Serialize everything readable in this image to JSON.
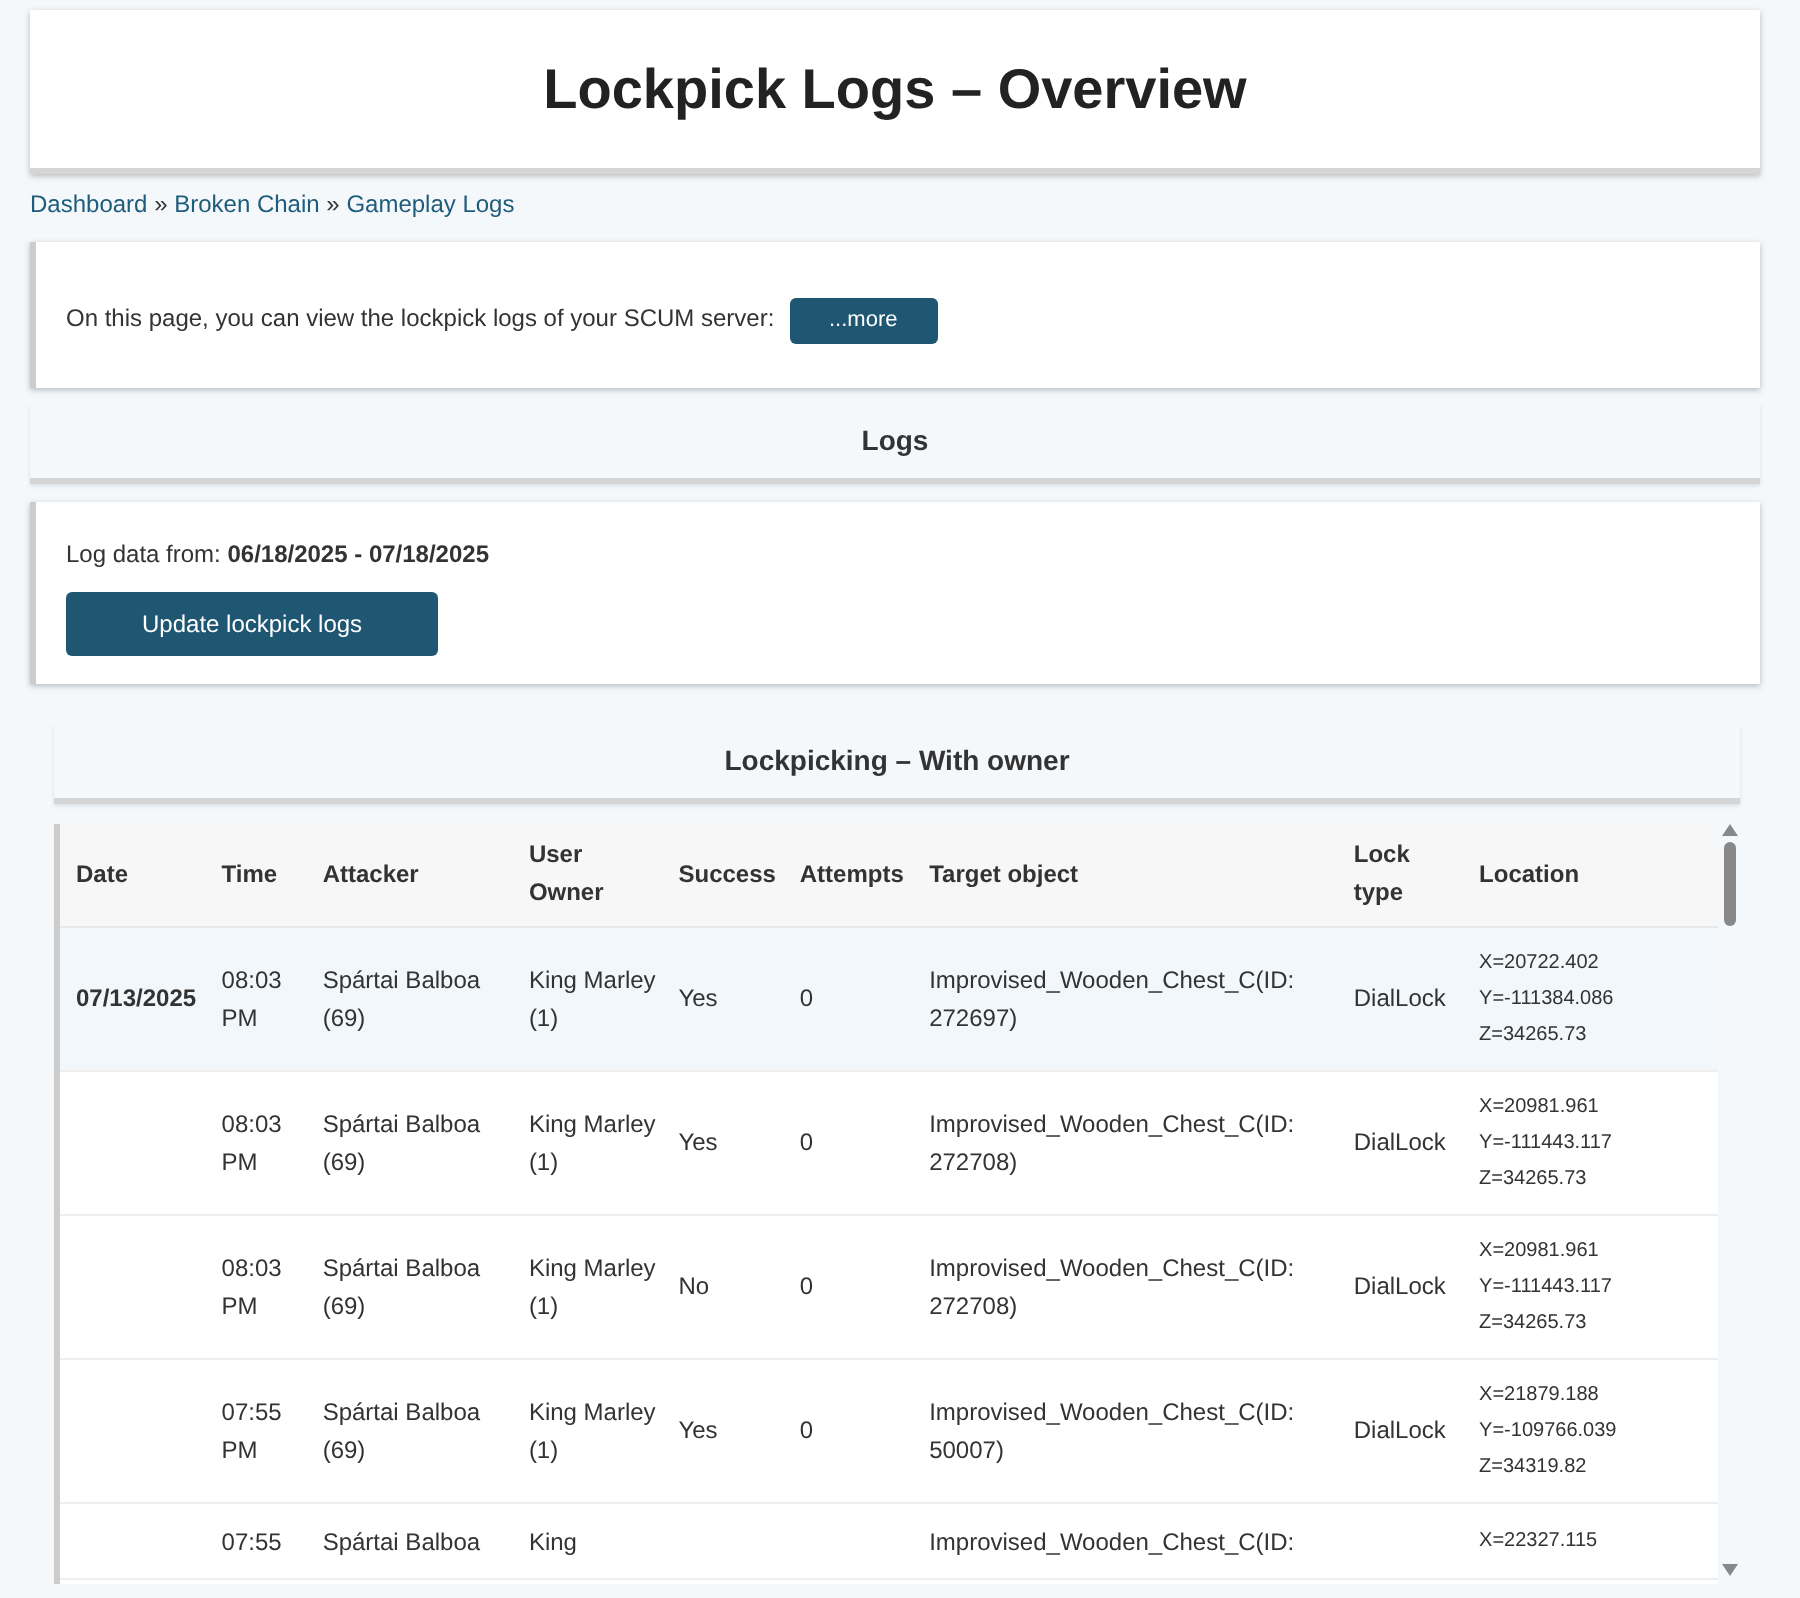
{
  "title": "Lockpick Logs – Overview",
  "breadcrumb": [
    "Dashboard",
    "Broken Chain",
    "Gameplay Logs"
  ],
  "breadcrumb_separator": "»",
  "info": {
    "text": "On this page, you can view the lockpick logs of your SCUM server:",
    "button": "...more"
  },
  "logs_header": "Logs",
  "log_range": "Log data from: **06/18/2025 - 07/18/2025**",
  "update_button": "Update lockpick logs",
  "section_title": "Lockpicking – With owner",
  "table": {
    "columns": [
      "Date",
      "Time",
      "Attacker",
      "User Owner",
      "Success",
      "Attempts",
      "Target object",
      "Lock type",
      "Location"
    ],
    "rows": [
      {
        "selected": true,
        "date": "07/13/2025",
        "time": "08:03 PM",
        "attacker": "Spártai Balboa (69)",
        "owner": "King Marley (1)",
        "success": "Yes",
        "attempts": "0",
        "target": "Improvised_Wooden_Chest_C(ID: 272697)",
        "lock": "DialLock",
        "location": [
          "X=20722.402",
          "Y=-111384.086",
          "Z=34265.73"
        ]
      },
      {
        "selected": false,
        "time": "08:03 PM",
        "attacker": "Spártai Balboa (69)",
        "owner": "King Marley (1)",
        "success": "Yes",
        "attempts": "0",
        "target": "Improvised_Wooden_Chest_C(ID: 272708)",
        "lock": "DialLock",
        "location": [
          "X=20981.961",
          "Y=-111443.117",
          "Z=34265.73"
        ]
      },
      {
        "selected": false,
        "time": "08:03 PM",
        "attacker": "Spártai Balboa (69)",
        "owner": "King Marley (1)",
        "success": "No",
        "attempts": "0",
        "target": "Improvised_Wooden_Chest_C(ID: 272708)",
        "lock": "DialLock",
        "location": [
          "X=20981.961",
          "Y=-111443.117",
          "Z=34265.73"
        ]
      },
      {
        "selected": false,
        "time": "07:55 PM",
        "attacker": "Spártai Balboa (69)",
        "owner": "King Marley (1)",
        "success": "Yes",
        "attempts": "0",
        "target": "Improvised_Wooden_Chest_C(ID: 50007)",
        "lock": "DialLock",
        "location": [
          "X=21879.188",
          "Y=-109766.039",
          "Z=34319.82"
        ]
      },
      {
        "selected": false,
        "time": "07:55",
        "attacker": "Spártai Balboa",
        "owner": "King",
        "target": "Improvised_Wooden_Chest_C(ID:",
        "location": [
          "X=22327.115"
        ]
      }
    ]
  }
}
